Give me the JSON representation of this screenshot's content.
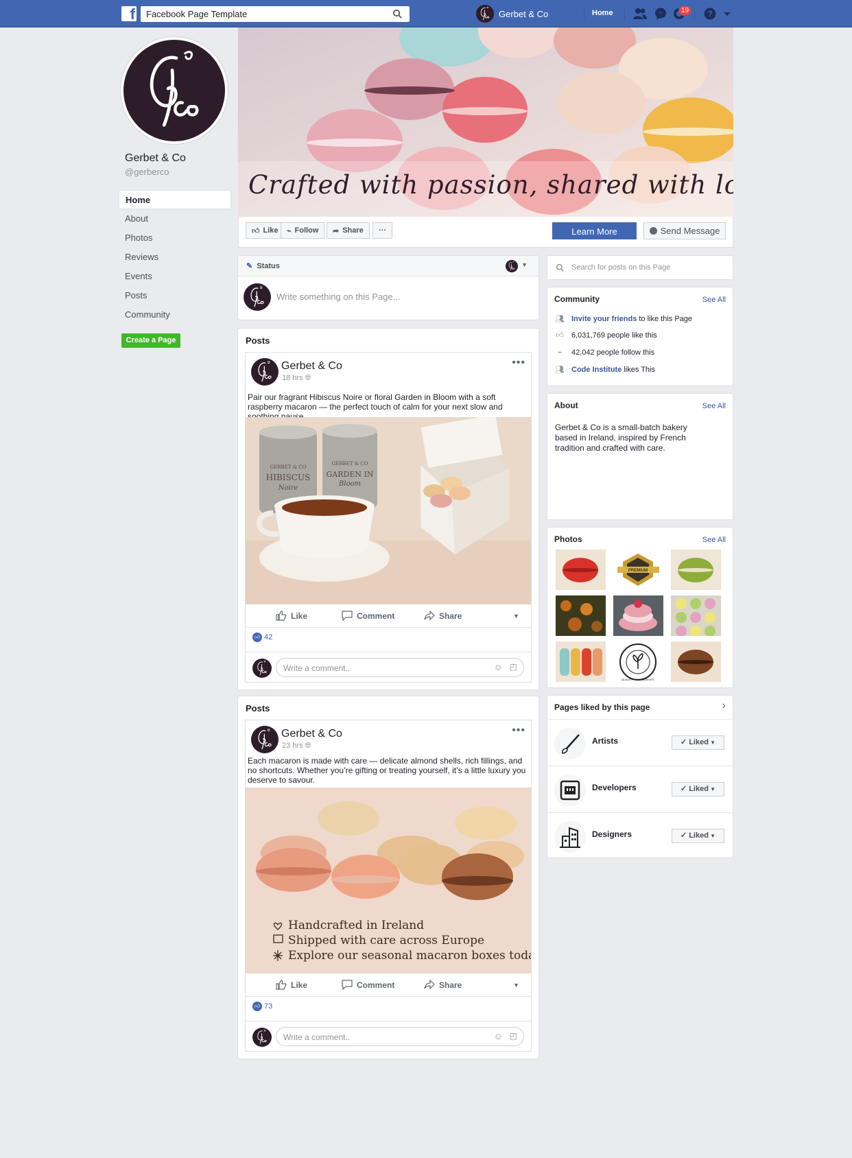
{
  "topbar": {
    "search_value": "Facebook Page Template",
    "profile_name": "Gerbet & Co",
    "home_label": "Home",
    "notification_count": "19"
  },
  "left": {
    "page_name": "Gerbet & Co",
    "handle": "@gerberco",
    "nav": [
      "Home",
      "About",
      "Photos",
      "Reviews",
      "Events",
      "Posts",
      "Community"
    ],
    "create_page": "Create a Page"
  },
  "cover": {
    "caption": "Crafted with passion, shared with love"
  },
  "actions": {
    "like": "Like",
    "follow": "Follow",
    "share": "Share",
    "more": "···",
    "learn_more": "Learn More",
    "send_message": "Send Message"
  },
  "status": {
    "label": "Status",
    "placeholder": "Write something on this Page..."
  },
  "posts": [
    {
      "header": "Posts",
      "author": "Gerbet & Co",
      "time": "18 hrs",
      "text": "Pair our fragrant Hibiscus Noire or floral Garden in Bloom with a soft raspberry macaron — the perfect touch of calm for your next slow and soothing pause.",
      "tin1_brand": "GERBET & CO",
      "tin1_name": "HIBISCUS",
      "tin1_sub": "Noire",
      "tin2_brand": "GERBET & CO",
      "tin2_name": "GARDEN IN",
      "tin2_sub": "Bloom",
      "like": "Like",
      "comment": "Comment",
      "share": "Share",
      "likes": "42",
      "comment_placeholder": "Write a comment.."
    },
    {
      "header": "Posts",
      "author": "Gerbet & Co",
      "time": "23 hrs",
      "text": "Each macaron is made with care — delicate almond shells, rich fillings, and no shortcuts. Whether you’re gifting or treating yourself, it’s a little luxury you deserve to savour.",
      "features": [
        "Handcrafted in Ireland",
        "Shipped with care across Europe",
        "Explore our seasonal macaron boxes today"
      ],
      "like": "Like",
      "comment": "Comment",
      "share": "Share",
      "likes": "73",
      "comment_placeholder": "Write a comment.."
    }
  ],
  "right": {
    "search_placeholder": "Search for posts on this Page",
    "community": {
      "title": "Community",
      "see_all": "See All",
      "invite_link": "Invite your friends",
      "invite_rest": "to like this Page",
      "likes": "6,031,769 people like this",
      "follows": "42,042 people follow this",
      "friend_link": "Code Institute",
      "friend_rest": "likes This"
    },
    "about": {
      "title": "About",
      "see_all": "See All",
      "text": "Gerbet & Co is a small-batch bakery based in Ireland, inspired by French tradition and crafted with care."
    },
    "photos": {
      "title": "Photos",
      "see_all": "See All",
      "badge_premium": "PREMIUM",
      "badge_quality": "QUALITY · INGREDIENTS"
    },
    "pages_liked": {
      "title": "Pages liked by this page",
      "items": [
        {
          "name": "Artists",
          "button": "Liked"
        },
        {
          "name": "Developers",
          "button": "Liked"
        },
        {
          "name": "Designers",
          "button": "Liked"
        }
      ]
    }
  },
  "colors": {
    "brand_blue": "#4267b2",
    "page_bg": "#e9ebee",
    "create_green": "#42b72a",
    "logo_plum": "#2d1c2a"
  }
}
